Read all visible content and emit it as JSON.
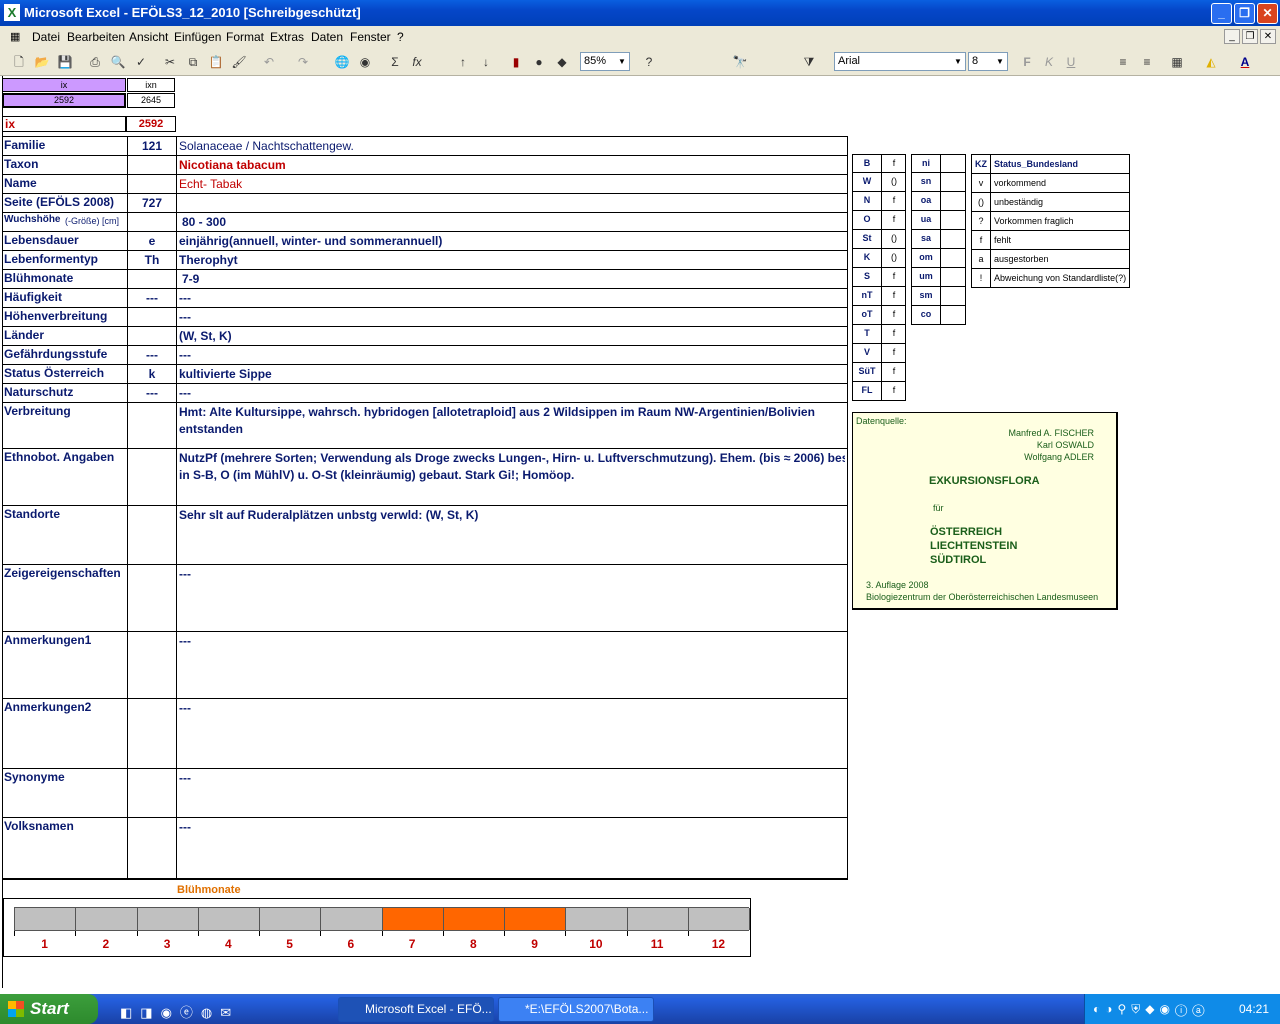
{
  "window": {
    "title": "Microsoft Excel - EFÖLS3_12_2010  [Schreibgeschützt]",
    "min": "_",
    "max": "❐",
    "close": "✕"
  },
  "menu": {
    "items": [
      "Datei",
      "Bearbeiten",
      "Ansicht",
      "Einfügen",
      "Format",
      "Extras",
      "Daten",
      "Fenster",
      "?"
    ]
  },
  "toolbar": {
    "zoom": "85%",
    "font": "Arial",
    "size": "8"
  },
  "index": {
    "ix_header": "ix",
    "ixn_header": "ixn",
    "ix_value": "2592",
    "ixn_value": "2645",
    "ix_label": "ix",
    "ix_big": "2592"
  },
  "fields": [
    {
      "label": "Familie",
      "code": "121",
      "text": "Solanaceae  /  Nachtschattengew."
    },
    {
      "label": "Taxon",
      "code": "",
      "text": "Nicotiana tabacum"
    },
    {
      "label": "Name",
      "code": "",
      "text": "Echt- Tabak"
    },
    {
      "label": "Seite (EFÖLS 2008)",
      "code": "727",
      "text": ""
    },
    {
      "label": "Wuchshöhe",
      "label_small": "(-Größe) [cm]",
      "code": "",
      "text": "80 - 300"
    },
    {
      "label": "Lebensdauer",
      "code": "e",
      "text": "einjährig(annuell, winter- und sommerannuell)"
    },
    {
      "label": "Lebenformentyp",
      "code": "Th",
      "text": "Therophyt"
    },
    {
      "label": "Blühmonate",
      "code": "",
      "text": "7-9"
    },
    {
      "label": "Häufigkeit",
      "code": "---",
      "text": "---"
    },
    {
      "label": "Höhenverbreitung",
      "code": "",
      "text": "---"
    },
    {
      "label": "Länder",
      "code": "",
      "text": "(W, St, K)"
    },
    {
      "label": "Gefährdungsstufe",
      "code": "---",
      "text": "---"
    },
    {
      "label": "Status Österreich",
      "code": "k",
      "text": "kultivierte Sippe"
    },
    {
      "label": "Naturschutz",
      "code": "---",
      "text": "---"
    },
    {
      "label": "Verbreitung",
      "code": "",
      "text": "Hmt: Alte Kultursippe, wahrsch. hybridogen [allotetraploid] aus 2 Wildsippen im Raum NW-Argentinien/Bolivien",
      "text2": "entstanden"
    },
    {
      "label": "Ethnobot. Angaben",
      "code": "",
      "text": "NutzPf (mehrere Sorten; Verwendung als Droge zwecks Lungen-, Hirn- u. Luftverschmutzung). Ehem. (bis ≈ 2006) bes.",
      "text2": "in S-B, O (im MühlV) u. O-St (kleinräumig) gebaut.  Stark Gi!; Homöop."
    },
    {
      "label": "Standorte",
      "code": "",
      "text": "Sehr slt auf Ruderalplätzen unbstg verwld: (W, St, K)"
    },
    {
      "label": "Zeigereigenschaften",
      "code": "",
      "text": "---"
    },
    {
      "label": "Anmerkungen1",
      "code": "",
      "text": "---"
    },
    {
      "label": "Anmerkungen2",
      "code": "",
      "text": "---"
    },
    {
      "label": "Synonyme",
      "code": "",
      "text": "---"
    },
    {
      "label": "Volksnamen",
      "code": "",
      "text": "---"
    }
  ],
  "states": [
    {
      "k": "B",
      "v": "f"
    },
    {
      "k": "W",
      "v": "()"
    },
    {
      "k": "N",
      "v": "f"
    },
    {
      "k": "O",
      "v": "f"
    },
    {
      "k": "St",
      "v": "()"
    },
    {
      "k": "K",
      "v": "()"
    },
    {
      "k": "S",
      "v": "f"
    },
    {
      "k": "nT",
      "v": "f"
    },
    {
      "k": "oT",
      "v": "f"
    },
    {
      "k": "T",
      "v": "f"
    },
    {
      "k": "V",
      "v": "f"
    },
    {
      "k": "SüT",
      "v": "f"
    },
    {
      "k": "FL",
      "v": "f"
    }
  ],
  "altitude": [
    "ni",
    "sn",
    "oa",
    "ua",
    "sa",
    "om",
    "um",
    "sm",
    "co"
  ],
  "legend": {
    "head_k": "KZ",
    "head_v": "Status_Bundesland",
    "rows": [
      {
        "k": "v",
        "v": "vorkommend"
      },
      {
        "k": "()",
        "v": "unbeständig"
      },
      {
        "k": "?",
        "v": "Vorkommen fraglich"
      },
      {
        "k": "f",
        "v": "fehlt"
      },
      {
        "k": "a",
        "v": "ausgestorben"
      },
      {
        "k": "!",
        "v": "Abweichung von Standardliste(?)"
      }
    ]
  },
  "source": {
    "label": "Datenquelle:",
    "authors": [
      "Manfred A. FISCHER",
      "Karl OSWALD",
      "Wolfgang ADLER"
    ],
    "title": "EXKURSIONSFLORA",
    "fuer": "für",
    "countries": [
      "ÖSTERREICH",
      "LIECHTENSTEIN",
      "SÜDTIROL"
    ],
    "edition": "3. Auflage 2008",
    "publisher": "Biologiezentrum der Oberösterreichischen Landesmuseen"
  },
  "bloom": {
    "title": "Blühmonate",
    "months": [
      "1",
      "2",
      "3",
      "4",
      "5",
      "6",
      "7",
      "8",
      "9",
      "10",
      "11",
      "12"
    ],
    "active": [
      7,
      8,
      9
    ],
    "active_color": "#ff6600",
    "inactive_color": "#c0c0c0"
  },
  "taskbar": {
    "start": "Start",
    "tasks": [
      "Microsoft Excel - EFÖ...",
      "*E:\\EFÖLS2007\\Bota..."
    ],
    "clock": "04:21"
  }
}
